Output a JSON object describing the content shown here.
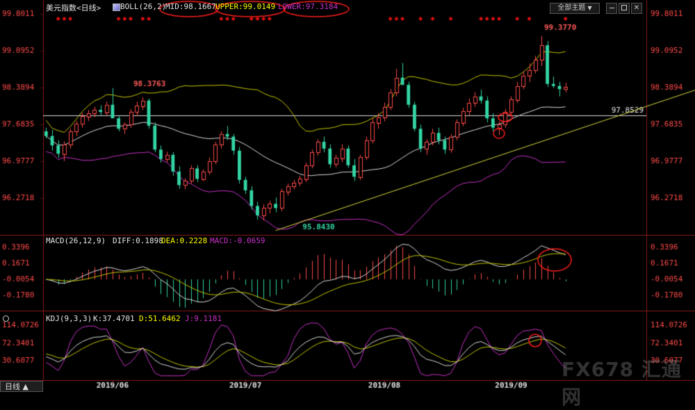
{
  "header": {
    "instrument": "美元指数<日线>",
    "boll_label": "BOLL(26,2)",
    "mid": "MID:98.1667",
    "upper": "UPPER:99.0149",
    "lower": "LOWER:97.3184",
    "theme_button": "全部主题",
    "theme_arrow": "▼"
  },
  "macd_header": {
    "title": "MACD(26,12,9)",
    "diff": "DIFF:0.1898",
    "dea": "DEA:0.2228",
    "macd": "MACD:-0.0659"
  },
  "kdj_header": {
    "title": "KDJ(9,3,3)",
    "k": "K:37.4701",
    "d": "D:51.6462",
    "j": "J:9.1181"
  },
  "footer": {
    "period_tab": "日线 ▲",
    "watermark": "FX678 汇通网"
  },
  "colors": {
    "up": "#ff4a4a",
    "down": "#33d6a5",
    "boll_upper": "#c8c800",
    "boll_mid": "#dcdcdc",
    "boll_lower": "#c832c8",
    "trendline": "#dcdc40",
    "annotation": "#ff1e1e"
  },
  "chart_data": {
    "type": "candlestick",
    "price_axis": {
      "ticks": [
        99.8011,
        99.0952,
        98.3894,
        97.6835,
        96.9777,
        96.2718
      ],
      "labels": [
        "99.8011",
        "99.0952",
        "98.3894",
        "97.6835",
        "96.9777",
        "96.2718"
      ]
    },
    "x_labels": [
      "2019/06",
      "2019/07",
      "2019/08",
      "2019/09"
    ],
    "x_label_index": [
      11,
      33,
      56,
      77
    ],
    "annotations": {
      "high": {
        "label": "98.3763",
        "value": 98.3763,
        "index": 14
      },
      "low": {
        "label": "95.8430",
        "value": 95.843,
        "index": 42
      },
      "recent_high": {
        "label": "99.3770",
        "value": 99.377,
        "index": 98
      },
      "hline": {
        "label": "97.8529",
        "value": 97.8529
      }
    },
    "trendline": {
      "from": {
        "index": 38,
        "value": 95.65
      },
      "to": {
        "index": 125,
        "value": 99.02
      }
    },
    "candles": [
      [
        97.55,
        97.62,
        97.42,
        97.46
      ],
      [
        97.46,
        97.58,
        97.18,
        97.28
      ],
      [
        97.28,
        97.38,
        97.04,
        97.12
      ],
      [
        97.12,
        97.36,
        96.98,
        97.3
      ],
      [
        97.3,
        97.6,
        97.22,
        97.55
      ],
      [
        97.55,
        97.75,
        97.46,
        97.7
      ],
      [
        97.7,
        97.9,
        97.62,
        97.84
      ],
      [
        97.84,
        97.96,
        97.75,
        97.9
      ],
      [
        97.9,
        98.02,
        97.82,
        97.96
      ],
      [
        97.96,
        98.05,
        97.86,
        97.92
      ],
      [
        97.92,
        98.12,
        97.86,
        98.06
      ],
      [
        98.06,
        98.38,
        97.98,
        97.8
      ],
      [
        97.8,
        97.85,
        97.55,
        97.6
      ],
      [
        97.6,
        97.72,
        97.5,
        97.68
      ],
      [
        97.68,
        97.98,
        97.62,
        97.92
      ],
      [
        97.92,
        98.12,
        97.84,
        98.04
      ],
      [
        98.04,
        98.2,
        97.96,
        98.14
      ],
      [
        98.14,
        98.18,
        97.6,
        97.66
      ],
      [
        97.66,
        97.72,
        97.15,
        97.2
      ],
      [
        97.2,
        97.28,
        96.95,
        97.02
      ],
      [
        97.02,
        97.16,
        96.96,
        97.1
      ],
      [
        97.1,
        97.15,
        96.7,
        96.78
      ],
      [
        96.78,
        96.88,
        96.45,
        96.52
      ],
      [
        96.52,
        96.65,
        96.44,
        96.6
      ],
      [
        96.6,
        96.9,
        96.55,
        96.84
      ],
      [
        96.84,
        96.9,
        96.58,
        96.64
      ],
      [
        96.64,
        96.82,
        96.6,
        96.78
      ],
      [
        96.78,
        97.05,
        96.72,
        96.98
      ],
      [
        96.98,
        97.35,
        96.92,
        97.3
      ],
      [
        97.3,
        97.55,
        97.22,
        97.5
      ],
      [
        97.5,
        97.65,
        97.38,
        97.45
      ],
      [
        97.45,
        97.5,
        97.1,
        97.18
      ],
      [
        97.18,
        97.25,
        96.55,
        96.62
      ],
      [
        96.62,
        96.68,
        96.35,
        96.42
      ],
      [
        96.42,
        96.5,
        96.05,
        96.12
      ],
      [
        96.12,
        96.2,
        95.86,
        95.94
      ],
      [
        95.94,
        96.15,
        95.843,
        96.08
      ],
      [
        96.08,
        96.22,
        95.98,
        96.16
      ],
      [
        96.16,
        96.28,
        96.0,
        96.08
      ],
      [
        96.08,
        96.45,
        96.02,
        96.4
      ],
      [
        96.4,
        96.55,
        96.32,
        96.5
      ],
      [
        96.5,
        96.62,
        96.44,
        96.56
      ],
      [
        96.56,
        96.7,
        96.5,
        96.64
      ],
      [
        96.64,
        96.95,
        96.58,
        96.9
      ],
      [
        96.9,
        97.2,
        96.84,
        97.15
      ],
      [
        97.15,
        97.4,
        97.08,
        97.35
      ],
      [
        97.35,
        97.45,
        97.15,
        97.22
      ],
      [
        97.22,
        97.3,
        96.85,
        96.92
      ],
      [
        96.92,
        97.1,
        96.86,
        97.04
      ],
      [
        97.04,
        97.3,
        96.96,
        97.22
      ],
      [
        97.22,
        97.28,
        96.85,
        96.9
      ],
      [
        96.9,
        97.02,
        96.6,
        96.68
      ],
      [
        96.68,
        97.1,
        96.62,
        97.06
      ],
      [
        97.06,
        97.45,
        97.0,
        97.38
      ],
      [
        97.38,
        97.8,
        97.32,
        97.72
      ],
      [
        97.72,
        97.9,
        97.6,
        97.82
      ],
      [
        97.82,
        98.1,
        97.74,
        98.02
      ],
      [
        98.02,
        98.36,
        97.96,
        98.3
      ],
      [
        98.3,
        98.75,
        98.22,
        98.58
      ],
      [
        98.58,
        98.86,
        98.5,
        98.44
      ],
      [
        98.44,
        98.5,
        98.0,
        98.06
      ],
      [
        98.06,
        98.12,
        97.55,
        97.6
      ],
      [
        97.6,
        97.68,
        97.15,
        97.22
      ],
      [
        97.22,
        97.4,
        97.1,
        97.35
      ],
      [
        97.35,
        97.6,
        97.28,
        97.52
      ],
      [
        97.52,
        97.62,
        97.3,
        97.38
      ],
      [
        97.38,
        97.45,
        97.12,
        97.2
      ],
      [
        97.2,
        97.5,
        97.14,
        97.44
      ],
      [
        97.44,
        97.78,
        97.38,
        97.72
      ],
      [
        97.72,
        98.0,
        97.65,
        97.94
      ],
      [
        97.94,
        98.18,
        97.86,
        98.1
      ],
      [
        98.1,
        98.3,
        98.02,
        98.22
      ],
      [
        98.22,
        98.35,
        98.08,
        98.14
      ],
      [
        98.14,
        98.22,
        97.72,
        97.8
      ],
      [
        97.8,
        97.9,
        97.55,
        97.62
      ],
      [
        97.62,
        97.74,
        97.48,
        97.68
      ],
      [
        97.68,
        97.98,
        97.62,
        97.92
      ],
      [
        97.92,
        98.22,
        97.86,
        98.16
      ],
      [
        98.16,
        98.5,
        98.1,
        98.42
      ],
      [
        98.42,
        98.7,
        98.36,
        98.62
      ],
      [
        98.62,
        98.85,
        98.5,
        98.72
      ],
      [
        98.72,
        99.0,
        98.66,
        98.92
      ],
      [
        98.92,
        99.377,
        98.8,
        99.2
      ],
      [
        99.2,
        99.28,
        98.4,
        98.46
      ],
      [
        98.46,
        98.6,
        98.38,
        98.42
      ],
      [
        98.42,
        98.5,
        98.22,
        98.36
      ],
      [
        98.36,
        98.48,
        98.3,
        98.4
      ]
    ],
    "macd_axis": [
      "0.3396",
      "0.1671",
      "-0.0054",
      "-0.1780"
    ],
    "kdj_axis": [
      "114.0726",
      "72.3401",
      "30.6077"
    ]
  }
}
